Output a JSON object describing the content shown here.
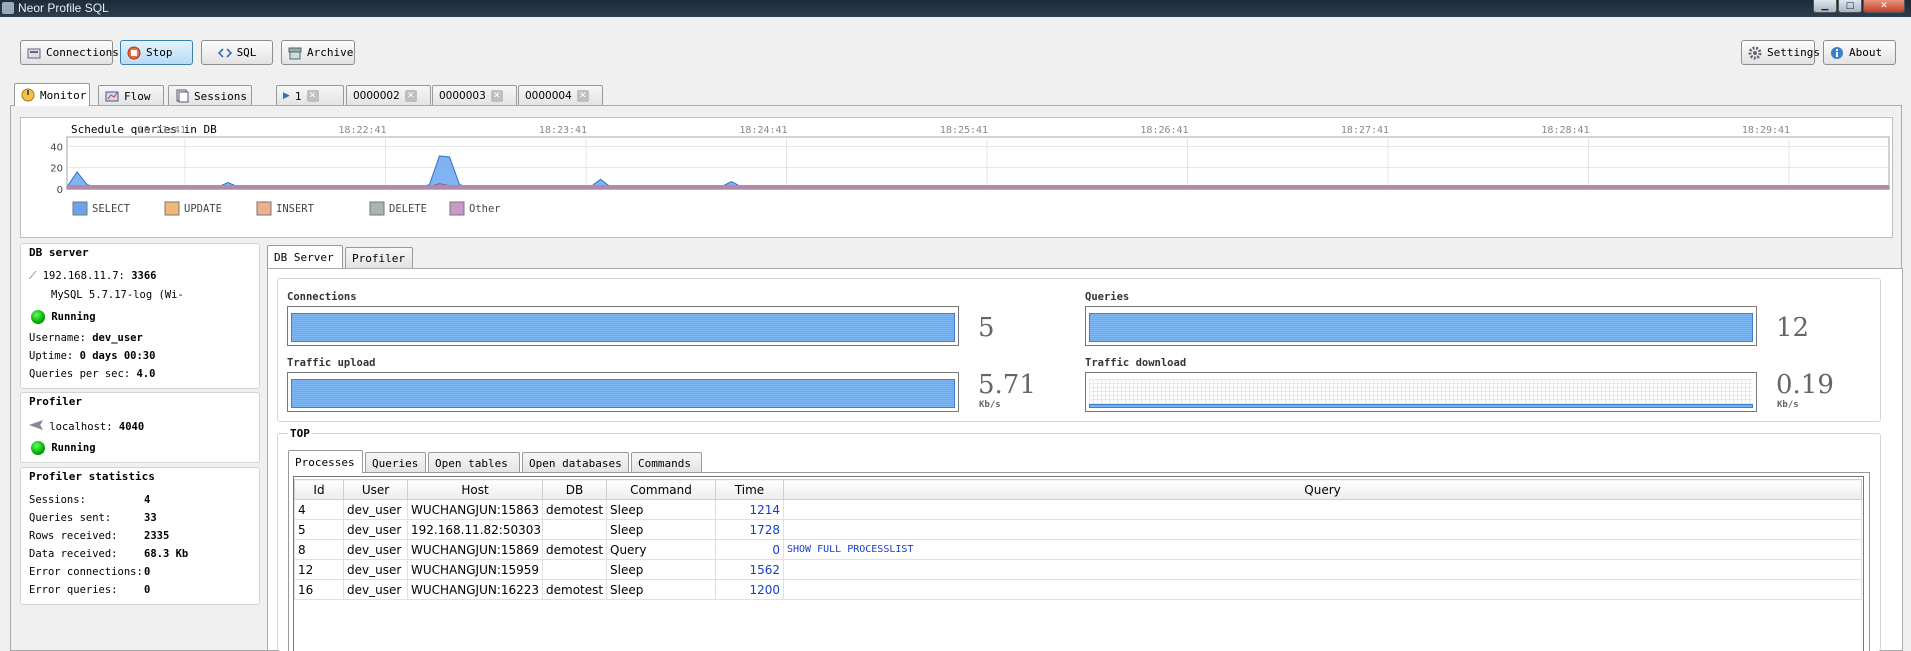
{
  "window": {
    "title": "Neor Profile SQL",
    "controls": {
      "minimize": "▁",
      "maximize": "□",
      "close": "✕"
    }
  },
  "toolbar": {
    "connections": "Connections",
    "stop": "Stop",
    "sql": "SQL",
    "archive": "Archive",
    "settings": "Settings",
    "about": "About"
  },
  "main_tabs": [
    {
      "label": "Monitor",
      "icon": "monitor-icon"
    },
    {
      "label": "Flow",
      "icon": "flow-icon"
    },
    {
      "label": "Sessions",
      "icon": "sessions-icon"
    }
  ],
  "session_tabs": [
    {
      "label": "1",
      "icon": "play-icon"
    },
    {
      "label": "0000002"
    },
    {
      "label": "0000003"
    },
    {
      "label": "0000004"
    }
  ],
  "chart_data": {
    "type": "area",
    "title": "Schedule queries in DB",
    "x_tick_labels": [
      "18:21:41",
      "18:22:41",
      "18:23:41",
      "18:24:41",
      "18:25:41",
      "18:26:41",
      "18:27:41",
      "18:28:41",
      "18:29:41"
    ],
    "y_tick_labels": [
      "40",
      "20",
      "0"
    ],
    "ylim": [
      0,
      45
    ],
    "grid": true,
    "legend_position": "bottom-left",
    "series": [
      {
        "name": "SELECT",
        "color": "#6aa6ee",
        "points": [
          [
            0,
            2
          ],
          [
            1,
            16
          ],
          [
            2,
            4
          ],
          [
            3,
            2
          ],
          [
            4,
            2
          ],
          [
            5,
            2
          ],
          [
            6,
            2
          ],
          [
            7,
            2
          ],
          [
            8,
            2
          ],
          [
            9,
            2
          ],
          [
            10,
            2
          ],
          [
            11,
            2
          ],
          [
            12,
            2
          ],
          [
            13,
            2
          ],
          [
            14,
            2
          ],
          [
            15,
            2
          ],
          [
            16,
            6
          ],
          [
            17,
            2
          ],
          [
            18,
            2
          ],
          [
            19,
            2
          ],
          [
            20,
            2
          ],
          [
            21,
            2
          ],
          [
            22,
            2
          ],
          [
            23,
            2
          ],
          [
            24,
            2
          ],
          [
            25,
            2
          ],
          [
            26,
            2
          ],
          [
            27,
            2
          ],
          [
            28,
            2
          ],
          [
            29,
            2
          ],
          [
            30,
            2
          ],
          [
            31,
            2
          ],
          [
            32,
            2
          ],
          [
            33,
            2
          ],
          [
            34,
            2
          ],
          [
            35,
            2
          ],
          [
            36,
            4
          ],
          [
            37,
            31
          ],
          [
            38,
            30
          ],
          [
            39,
            4
          ],
          [
            40,
            2
          ],
          [
            45,
            2
          ],
          [
            50,
            2
          ],
          [
            52,
            2
          ],
          [
            53,
            9
          ],
          [
            54,
            2
          ],
          [
            60,
            2
          ],
          [
            65,
            2
          ],
          [
            66,
            7
          ],
          [
            67,
            2
          ],
          [
            80,
            2
          ],
          [
            100,
            2
          ],
          [
            130,
            2
          ],
          [
            160,
            2
          ],
          [
            181,
            2
          ]
        ]
      },
      {
        "name": "UPDATE",
        "color": "#f0b878",
        "points": []
      },
      {
        "name": "INSERT",
        "color": "#eeb08c",
        "points": []
      },
      {
        "name": "DELETE",
        "color": "#aab4ae",
        "points": []
      },
      {
        "name": "Other",
        "color": "#c89ac8",
        "points": [
          [
            0,
            2
          ],
          [
            36,
            2
          ],
          [
            37,
            5
          ],
          [
            38,
            3
          ],
          [
            39,
            2
          ],
          [
            181,
            2
          ]
        ]
      }
    ]
  },
  "db_server": {
    "title": "DB server",
    "host": "192.168.11.7:",
    "port": "3366",
    "version": "MySQL 5.7.17-log (Wi-",
    "status": "Running",
    "username_label": "Username:",
    "username": "dev_user",
    "uptime_label": "Uptime:",
    "uptime": "0 days 00:30",
    "qps_label": "Queries per sec:",
    "qps": "4.0"
  },
  "profiler": {
    "title": "Profiler",
    "host": "localhost:",
    "port": "4040",
    "status": "Running"
  },
  "profiler_stats": {
    "title": "Profiler statistics",
    "rows": [
      {
        "label": "Sessions:",
        "value": "4"
      },
      {
        "label": "Queries sent:",
        "value": "33"
      },
      {
        "label": "Rows received:",
        "value": "2335"
      },
      {
        "label": "Data received:",
        "value": "68.3 Kb"
      },
      {
        "label": "Error connections:",
        "value": "0"
      },
      {
        "label": "Error queries:",
        "value": "0"
      }
    ]
  },
  "right_tabs": [
    "DB Server",
    "Profiler"
  ],
  "meters": {
    "connections": {
      "label": "Connections",
      "value": "5",
      "fill": 1.0
    },
    "queries": {
      "label": "Queries",
      "value": "12",
      "fill": 1.0
    },
    "traffic_upload": {
      "label": "Traffic upload",
      "value": "5.71",
      "unit": "Kb/s",
      "fill": 1.0
    },
    "traffic_download": {
      "label": "Traffic download",
      "value": "0.19",
      "unit": "Kb/s",
      "fill": 0.03
    }
  },
  "top": {
    "title": "TOP",
    "tabs": [
      "Processes",
      "Queries",
      "Open tables",
      "Open databases",
      "Commands"
    ],
    "columns": [
      "Id",
      "User",
      "Host",
      "DB",
      "Command",
      "Time",
      "Query"
    ],
    "rows": [
      [
        "4",
        "dev_user",
        "WUCHANGJUN:15863",
        "demotest",
        "Sleep",
        "1214",
        ""
      ],
      [
        "5",
        "dev_user",
        "192.168.11.82:50303",
        "",
        "Sleep",
        "1728",
        ""
      ],
      [
        "8",
        "dev_user",
        "WUCHANGJUN:15869",
        "demotest",
        "Query",
        "0",
        "SHOW FULL PROCESSLIST"
      ],
      [
        "12",
        "dev_user",
        "WUCHANGJUN:15959",
        "",
        "Sleep",
        "1562",
        ""
      ],
      [
        "16",
        "dev_user",
        "WUCHANGJUN:16223",
        "demotest",
        "Sleep",
        "1200",
        ""
      ]
    ]
  }
}
